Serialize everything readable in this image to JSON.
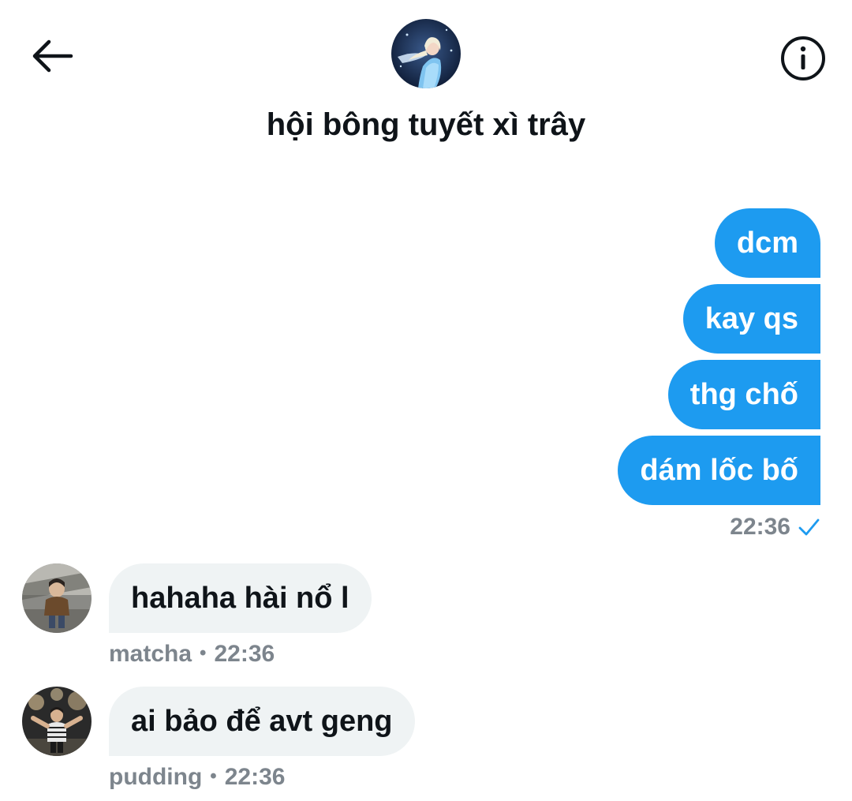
{
  "header": {
    "title": "hội bông tuyết xì trây",
    "back_icon": "arrow-left-icon",
    "info_icon": "info-circle-icon",
    "group_avatar": "group-avatar-elsa"
  },
  "colors": {
    "accent": "#1d9bf0",
    "incoming_bubble": "#eff3f4",
    "meta_text": "#7d858d"
  },
  "outgoing": {
    "messages": [
      "dcm",
      "kay qs",
      "thg chố",
      "dám lốc bố"
    ],
    "time": "22:36",
    "status_icon": "sent-check-icon"
  },
  "incoming": [
    {
      "sender": "matcha",
      "time": "22:36",
      "text": "hahaha hài nổ l"
    },
    {
      "sender": "pudding",
      "time": "22:36",
      "text": "ai bảo để avt geng"
    }
  ],
  "separator": "•"
}
